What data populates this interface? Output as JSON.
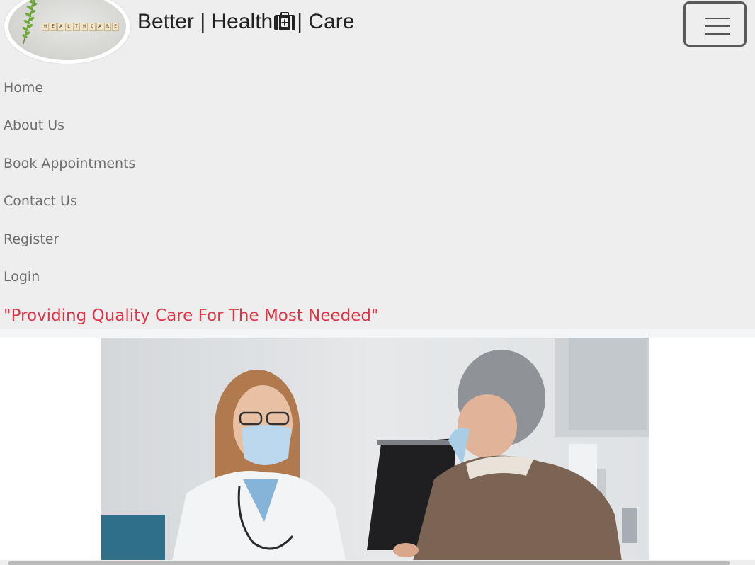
{
  "header": {
    "logo_text": "HEALTHCARE",
    "brand_left": "Better | Health",
    "brand_right": "| Care",
    "brand_icon": "medical-kit-icon",
    "toggler_icon": "hamburger-menu-icon"
  },
  "nav": {
    "items": [
      {
        "label": "Home"
      },
      {
        "label": "About Us"
      },
      {
        "label": "Book Appointments"
      },
      {
        "label": "Contact Us"
      },
      {
        "label": "Register"
      },
      {
        "label": "Login"
      }
    ]
  },
  "tagline": "\"Providing Quality Care For The Most Needed\"",
  "colors": {
    "navbar_bg": "#eeeeee",
    "tagline": "#dc3545",
    "nav_link": "#6e6e6e"
  }
}
